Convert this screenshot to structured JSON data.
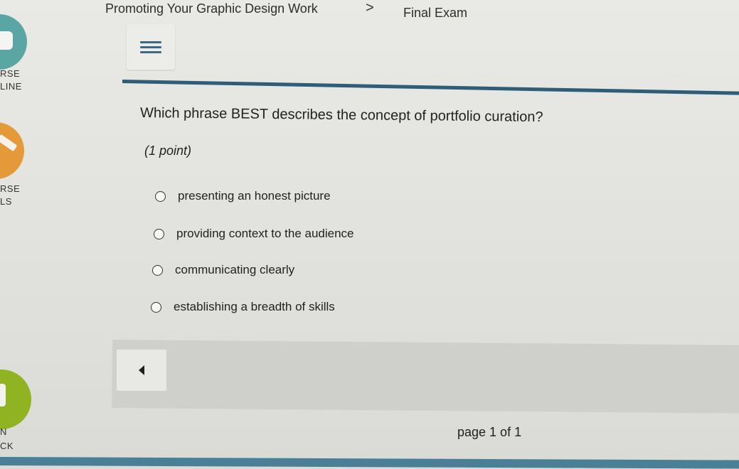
{
  "breadcrumb": {
    "course": "Promoting Your Graphic Design Work",
    "separator": ">",
    "current": "Final Exam"
  },
  "sidebar": {
    "labels": [
      "RSE",
      "LINE",
      "RSE",
      "LS",
      "N",
      "CK"
    ]
  },
  "menu": {
    "icon": "hamburger-icon"
  },
  "question": {
    "text": "Which phrase BEST describes the concept of portfolio curation?",
    "points": "(1 point)",
    "options": [
      "presenting an honest picture",
      "providing context to the audience",
      "communicating clearly",
      "establishing a breadth of skills"
    ]
  },
  "navigation": {
    "prev_icon": "triangle-left-icon",
    "page": "page 1 of 1"
  },
  "colors": {
    "accent": "#2f5c78",
    "teal": "#5aa6a4",
    "orange": "#e59a3a",
    "green": "#8fb321"
  }
}
